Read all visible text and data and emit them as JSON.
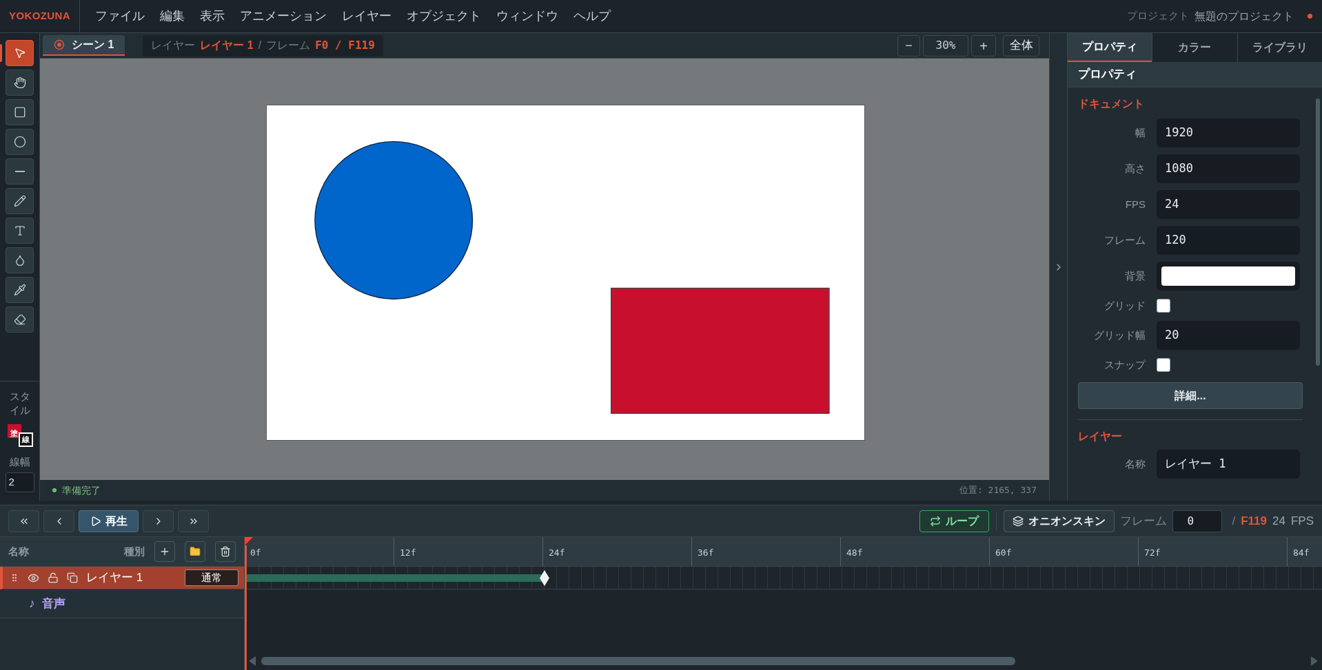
{
  "app": {
    "logo": "YOKOZUNA"
  },
  "menu": [
    "ファイル",
    "編集",
    "表示",
    "アニメーション",
    "レイヤー",
    "オブジェクト",
    "ウィンドウ",
    "ヘルプ"
  ],
  "project": {
    "label": "プロジェクト",
    "name": "無題のプロジェクト",
    "unsaved": true
  },
  "tools": [
    {
      "kind": "select",
      "selected": true
    },
    {
      "kind": "hand",
      "selected": false
    },
    {
      "kind": "rect",
      "selected": false
    },
    {
      "kind": "ellipse",
      "selected": false
    },
    {
      "kind": "line",
      "selected": false
    },
    {
      "kind": "pencil",
      "selected": false
    },
    {
      "kind": "text",
      "selected": false
    },
    {
      "kind": "fill",
      "selected": false
    },
    {
      "kind": "eyedropper",
      "selected": false
    },
    {
      "kind": "eraser",
      "selected": false
    }
  ],
  "style": {
    "title": "スタイル",
    "swatches": [
      {
        "kind": "fill",
        "label": "塗",
        "color": "#c8102e"
      },
      {
        "kind": "stroke",
        "label": "線",
        "color": "#111111"
      }
    ],
    "width_label": "線幅",
    "width_value": "2"
  },
  "scene_tab": {
    "label": "シーン 1",
    "selected": true
  },
  "breadcrumb": {
    "layer_label": "レイヤー",
    "layer": "レイヤー 1",
    "separator": "/",
    "frame_label": "フレーム",
    "frame": "F0 / F119"
  },
  "zoom": {
    "minus": "−",
    "value": "30%",
    "plus": "+",
    "fit": "全体"
  },
  "status_bar": {
    "text": "準備完了",
    "position": "位置: 2165, 337"
  },
  "panel": {
    "tabs": [
      {
        "label": "プロパティ",
        "selected": true
      },
      {
        "label": "カラー",
        "selected": false
      },
      {
        "label": "ライブラリ",
        "selected": false
      }
    ],
    "header": "プロパティ",
    "document": {
      "title": "ドキュメント",
      "fields": [
        {
          "kind": "text",
          "label": "幅",
          "value": "1920"
        },
        {
          "kind": "text",
          "label": "高さ",
          "value": "1080"
        },
        {
          "kind": "text",
          "label": "FPS",
          "value": "24"
        },
        {
          "kind": "text",
          "label": "フレーム",
          "value": "120"
        },
        {
          "kind": "color",
          "label": "背景",
          "color": "#ffffff"
        },
        {
          "kind": "checkbox",
          "label": "グリッド",
          "checked": false
        },
        {
          "kind": "text",
          "label": "グリッド幅",
          "value": "20"
        },
        {
          "kind": "checkbox",
          "label": "スナップ",
          "checked": false
        }
      ],
      "button": "詳細..."
    },
    "layer": {
      "title": "レイヤー",
      "fields": [
        {
          "kind": "text",
          "label": "名称",
          "value": "レイヤー 1"
        }
      ]
    }
  },
  "transport": {
    "play": "再生",
    "loop": {
      "label": "ループ",
      "on": true
    },
    "onion": {
      "label": "オニオンスキン",
      "on": false
    },
    "frame_label": "フレーム",
    "frame_value": "0",
    "separator": "/",
    "total": "F119",
    "fps": "24",
    "fps_unit": "FPS"
  },
  "timeline": {
    "name_header": "名称",
    "type_header": "種別",
    "ruler": [
      "0f",
      "12f",
      "24f",
      "36f",
      "48f",
      "60f",
      "72f",
      "84f"
    ],
    "layers": [
      {
        "kind": "layer",
        "name": "レイヤー 1",
        "type": "通常",
        "selected": true
      },
      {
        "kind": "audio",
        "icon": "♪",
        "name": "音声"
      }
    ]
  }
}
